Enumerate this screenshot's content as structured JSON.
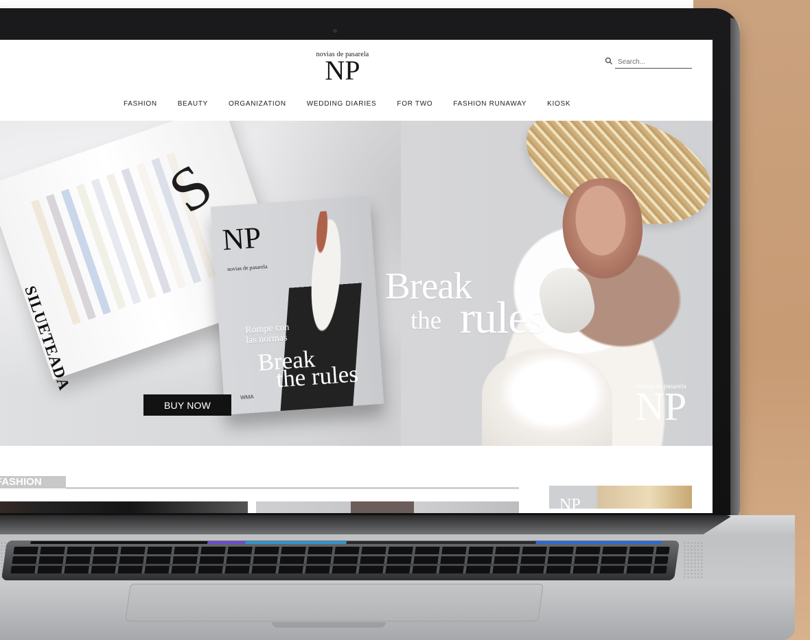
{
  "logo": {
    "top_text": "novias de pasarela",
    "main_text": "NP"
  },
  "search": {
    "placeholder": "Search..."
  },
  "nav": {
    "items": [
      {
        "label": "FASHION"
      },
      {
        "label": "BEAUTY"
      },
      {
        "label": "ORGANIZATION"
      },
      {
        "label": "WEDDING DIARIES"
      },
      {
        "label": "FOR TWO"
      },
      {
        "label": "FASHION RUNAWAY"
      },
      {
        "label": "KIOSK"
      }
    ]
  },
  "hero": {
    "title_line_1": "Break",
    "title_line_2_small": "the",
    "title_line_2_big": "rules",
    "buy_label": "BUY NOW",
    "watermark_top": "novias de pasarela",
    "watermark_main": "NP"
  },
  "magazine_open": {
    "spine_text": "SILUETEADA",
    "big_letter": "S"
  },
  "magazine_cover": {
    "brand_small": "novias de pasarela",
    "logo": "NP",
    "tagline_line_1": "Rompe con",
    "tagline_line_2": "las normas",
    "title_line_1": "Break",
    "title_line_2": "the rules",
    "bottom_text": "WMA"
  },
  "sections": {
    "fashion_label": "FASHION"
  },
  "side_preview": {
    "logo": "NP"
  },
  "colors": {
    "nav_text": "#222222",
    "hero_text": "#ffffff",
    "buy_button": "#121212",
    "section_label": "#c8c8c8",
    "background_accent": "#cba783"
  },
  "icons": {
    "search": "search-icon"
  }
}
